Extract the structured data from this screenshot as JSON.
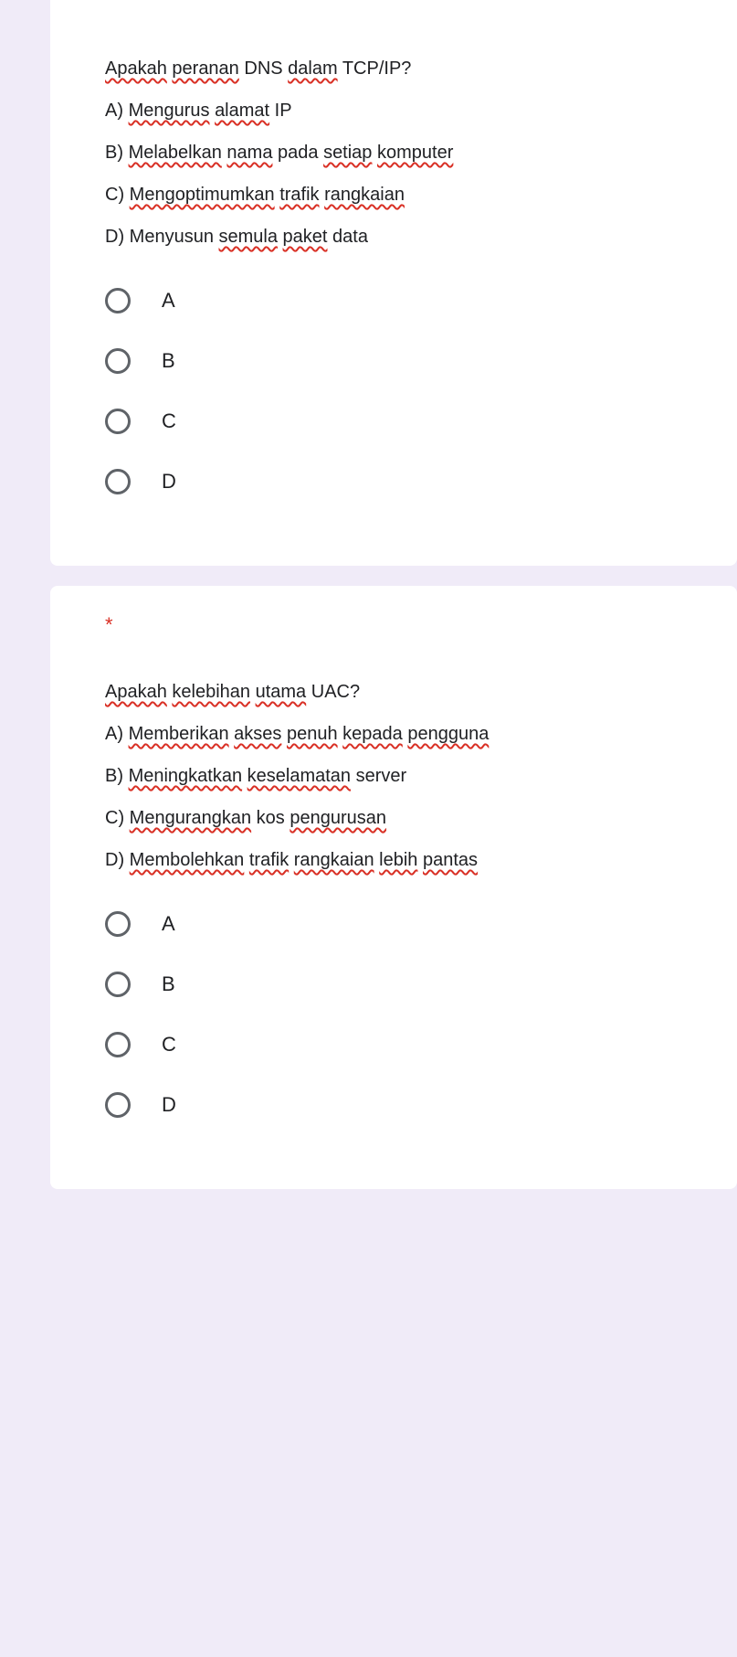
{
  "questions": [
    {
      "required": false,
      "lines": [
        {
          "segments": [
            {
              "t": "Apakah",
              "s": true
            },
            {
              "t": " "
            },
            {
              "t": "peranan",
              "s": true
            },
            {
              "t": " DNS "
            },
            {
              "t": "dalam",
              "s": true
            },
            {
              "t": " TCP/IP?"
            }
          ]
        },
        {
          "segments": [
            {
              "t": "A) "
            },
            {
              "t": "Mengurus",
              "s": true
            },
            {
              "t": " "
            },
            {
              "t": "alamat",
              "s": true
            },
            {
              "t": " IP"
            }
          ]
        },
        {
          "segments": [
            {
              "t": "B) "
            },
            {
              "t": "Melabelkan",
              "s": true
            },
            {
              "t": " "
            },
            {
              "t": "nama",
              "s": true
            },
            {
              "t": " pada "
            },
            {
              "t": "setiap",
              "s": true
            },
            {
              "t": " "
            },
            {
              "t": "komputer",
              "s": true
            }
          ]
        },
        {
          "segments": [
            {
              "t": "C) "
            },
            {
              "t": "Mengoptimumkan",
              "s": true
            },
            {
              "t": " "
            },
            {
              "t": "trafik",
              "s": true
            },
            {
              "t": " "
            },
            {
              "t": "rangkaian",
              "s": true
            }
          ]
        },
        {
          "segments": [
            {
              "t": "D) Menyusun "
            },
            {
              "t": "semula",
              "s": true
            },
            {
              "t": " "
            },
            {
              "t": "paket",
              "s": true
            },
            {
              "t": " data"
            }
          ]
        }
      ],
      "options": [
        "A",
        "B",
        "C",
        "D"
      ]
    },
    {
      "required": true,
      "required_mark": "*",
      "lines": [
        {
          "segments": [
            {
              "t": "Apakah",
              "s": true
            },
            {
              "t": " "
            },
            {
              "t": "kelebihan",
              "s": true
            },
            {
              "t": " "
            },
            {
              "t": "utama",
              "s": true
            },
            {
              "t": " UAC?"
            }
          ]
        },
        {
          "segments": [
            {
              "t": "A) "
            },
            {
              "t": "Memberikan",
              "s": true
            },
            {
              "t": " "
            },
            {
              "t": "akses",
              "s": true
            },
            {
              "t": " "
            },
            {
              "t": "penuh",
              "s": true
            },
            {
              "t": " "
            },
            {
              "t": "kepada",
              "s": true
            },
            {
              "t": " "
            },
            {
              "t": "pengguna",
              "s": true
            }
          ]
        },
        {
          "segments": [
            {
              "t": "B) "
            },
            {
              "t": "Meningkatkan",
              "s": true
            },
            {
              "t": " "
            },
            {
              "t": "keselamatan",
              "s": true
            },
            {
              "t": " server"
            }
          ]
        },
        {
          "segments": [
            {
              "t": "C) "
            },
            {
              "t": "Mengurangkan",
              "s": true
            },
            {
              "t": " kos "
            },
            {
              "t": "pengurusan",
              "s": true
            }
          ]
        },
        {
          "segments": [
            {
              "t": "D) "
            },
            {
              "t": "Membolehkan",
              "s": true
            },
            {
              "t": " "
            },
            {
              "t": "trafik",
              "s": true
            },
            {
              "t": " "
            },
            {
              "t": "rangkaian",
              "s": true
            },
            {
              "t": " "
            },
            {
              "t": "lebih",
              "s": true
            },
            {
              "t": " "
            },
            {
              "t": "pantas",
              "s": true
            }
          ]
        }
      ],
      "options": [
        "A",
        "B",
        "C",
        "D"
      ]
    }
  ]
}
